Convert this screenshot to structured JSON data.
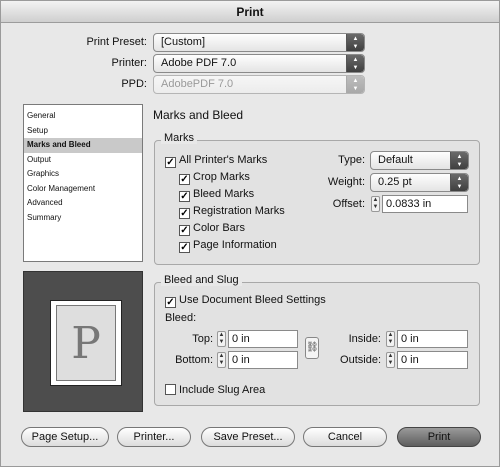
{
  "window": {
    "title": "Print"
  },
  "top": {
    "preset_label": "Print Preset:",
    "preset_value": "[Custom]",
    "printer_label": "Printer:",
    "printer_value": "Adobe PDF 7.0",
    "ppd_label": "PPD:",
    "ppd_value": "AdobePDF 7.0"
  },
  "sidebar": {
    "items": [
      {
        "label": "General"
      },
      {
        "label": "Setup"
      },
      {
        "label": "Marks and Bleed"
      },
      {
        "label": "Output"
      },
      {
        "label": "Graphics"
      },
      {
        "label": "Color Management"
      },
      {
        "label": "Advanced"
      },
      {
        "label": "Summary"
      }
    ],
    "selected": "Marks and Bleed"
  },
  "preview": {
    "letter": "P"
  },
  "panel": {
    "title": "Marks and Bleed"
  },
  "marks": {
    "title": "Marks",
    "all_label": "All Printer's Marks",
    "crop_label": "Crop Marks",
    "bleed_label": "Bleed Marks",
    "registration_label": "Registration Marks",
    "colorbars_label": "Color Bars",
    "pageinfo_label": "Page Information",
    "type_label": "Type:",
    "type_value": "Default",
    "weight_label": "Weight:",
    "weight_value": "0.25 pt",
    "offset_label": "Offset:",
    "offset_value": "0.0833 in",
    "checked_mark": "✓"
  },
  "bleed": {
    "title": "Bleed and Slug",
    "use_doc_label": "Use Document Bleed Settings",
    "bleed_label": "Bleed:",
    "top_label": "Top:",
    "top_value": "0 in",
    "bottom_label": "Bottom:",
    "bottom_value": "0 in",
    "inside_label": "Inside:",
    "inside_value": "0 in",
    "outside_label": "Outside:",
    "outside_value": "0 in",
    "slug_label": "Include Slug Area"
  },
  "buttons": {
    "page_setup": "Page Setup...",
    "printer": "Printer...",
    "save_preset": "Save Preset...",
    "cancel": "Cancel",
    "print": "Print"
  }
}
